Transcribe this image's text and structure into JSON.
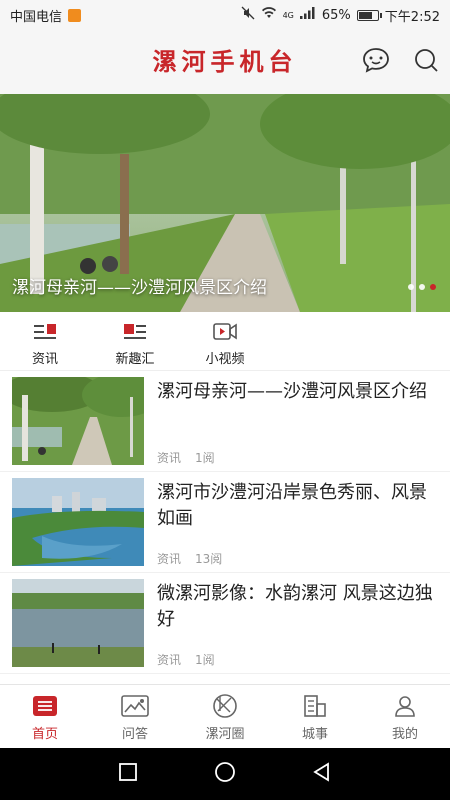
{
  "status": {
    "carrier": "中国电信",
    "network": "4G",
    "battery": "65%",
    "battery_level": 0.65,
    "time": "下午2:52"
  },
  "header": {
    "title": "漯河手机台"
  },
  "banner": {
    "caption": "漯河母亲河——沙澧河风景区介绍",
    "slide_count": 3,
    "active_slide": 2
  },
  "tabs": [
    {
      "label": "资讯",
      "icon": "news-icon"
    },
    {
      "label": "新趣汇",
      "icon": "fun-collection-icon"
    },
    {
      "label": "小视频",
      "icon": "video-icon"
    }
  ],
  "articles": [
    {
      "title": "漯河母亲河——沙澧河风景区介绍",
      "category": "资讯",
      "reads": "1阅"
    },
    {
      "title": "漯河市沙澧河沿岸景色秀丽、风景如画",
      "category": "资讯",
      "reads": "13阅"
    },
    {
      "title": "微漯河影像：水韵漯河 风景这边独好",
      "category": "资讯",
      "reads": "1阅"
    }
  ],
  "bottom_nav": [
    {
      "label": "首页",
      "icon": "home-icon",
      "active": true
    },
    {
      "label": "问答",
      "icon": "qa-icon",
      "active": false
    },
    {
      "label": "漯河圈",
      "icon": "circle-icon",
      "active": false
    },
    {
      "label": "城事",
      "icon": "city-icon",
      "active": false
    },
    {
      "label": "我的",
      "icon": "profile-icon",
      "active": false
    }
  ],
  "colors": {
    "brand_red": "#c8262a",
    "meta_gray": "#999999"
  }
}
